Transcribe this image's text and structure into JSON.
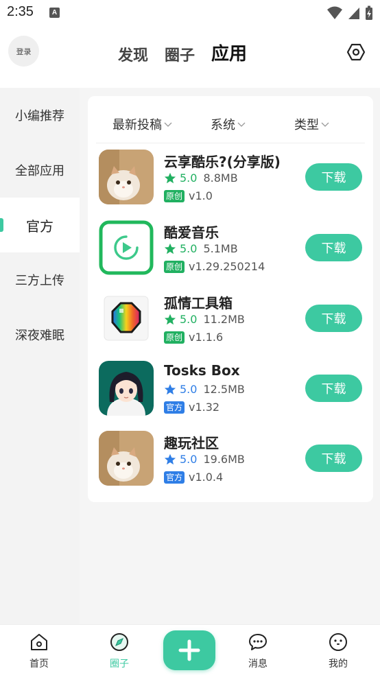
{
  "status_bar": {
    "time": "2:35",
    "notif_glyph": "A"
  },
  "header": {
    "login_label": "登录",
    "tabs": [
      {
        "label": "发现",
        "active": false
      },
      {
        "label": "圈子",
        "active": false
      },
      {
        "label": "应用",
        "active": true
      }
    ],
    "settings_icon": "settings-hexagon-icon"
  },
  "sidebar": {
    "items": [
      {
        "label": "小编推荐",
        "active": false
      },
      {
        "label": "全部应用",
        "active": false
      },
      {
        "label": "官方",
        "active": true
      },
      {
        "label": "三方上传",
        "active": false
      },
      {
        "label": "深夜难眠",
        "active": false
      }
    ]
  },
  "filters": [
    {
      "label": "最新投稿"
    },
    {
      "label": "系统"
    },
    {
      "label": "类型"
    }
  ],
  "apps": [
    {
      "name": "云享酷乐?(分享版)",
      "rating": "5.0",
      "size": "8.8MB",
      "tag": "原创",
      "version": "v1.0",
      "download_label": "下载",
      "icon": "cat-photo-icon"
    },
    {
      "name": "酷爱音乐",
      "rating": "5.0",
      "size": "5.1MB",
      "tag": "原创",
      "version": "v1.29.250214",
      "download_label": "下载",
      "icon": "music-play-icon"
    },
    {
      "name": "孤情工具箱",
      "rating": "5.0",
      "size": "11.2MB",
      "tag": "原创",
      "version": "v1.1.6",
      "download_label": "下载",
      "icon": "rainbow-gem-icon"
    },
    {
      "name": "Tosks Box",
      "rating": "5.0",
      "size": "12.5MB",
      "tag": "官方",
      "version": "v1.32",
      "download_label": "下载",
      "icon": "anime-girl-icon"
    },
    {
      "name": "趣玩社区",
      "rating": "5.0",
      "size": "19.6MB",
      "tag": "官方",
      "version": "v1.0.4",
      "download_label": "下载",
      "icon": "cat-photo-icon"
    }
  ],
  "bottom_nav": [
    {
      "label": "首页",
      "icon": "home-icon",
      "active": false
    },
    {
      "label": "圈子",
      "icon": "compass-icon",
      "active": true
    },
    {
      "label": "消息",
      "icon": "chat-icon",
      "active": false
    },
    {
      "label": "我的",
      "icon": "profile-face-icon",
      "active": false
    }
  ],
  "colors": {
    "accent": "#3dc9a1",
    "original_tag": "#21b061",
    "official_tag": "#2f7ee6",
    "rating_green": "#21b061",
    "rating_blue": "#2f7ee6"
  }
}
